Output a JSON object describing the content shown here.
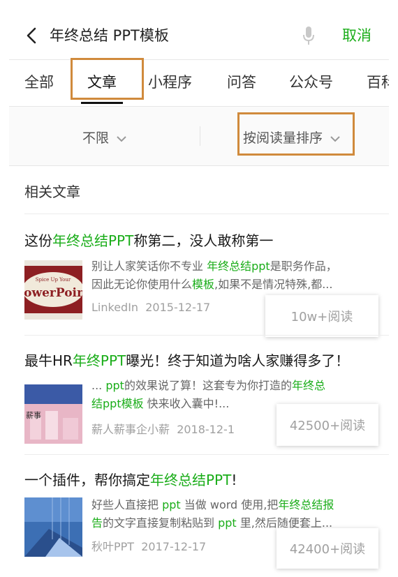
{
  "search": {
    "query": "年终总结 PPT模板",
    "cancel_label": "取消"
  },
  "tabs": [
    {
      "label": "全部"
    },
    {
      "label": "文章"
    },
    {
      "label": "小程序"
    },
    {
      "label": "问答"
    },
    {
      "label": "公众号"
    },
    {
      "label": "百科"
    }
  ],
  "active_tab": "文章",
  "filters": {
    "time_label": "不限",
    "sort_label": "按阅读量排序"
  },
  "section_title": "相关文章",
  "articles": [
    {
      "title_parts": [
        "这份",
        "年终总结PPT",
        "称第二，没人敢称第一"
      ],
      "snippet_line1": [
        "别让人家笑话你不专业 ",
        "年终总结ppt",
        "是职务作品，"
      ],
      "snippet_line2": [
        "因此无论你使用什么",
        "模板",
        ",如果不是情况特殊,都..."
      ],
      "source": "LinkedIn",
      "date": "2015-12-17",
      "reads": "10w+阅读",
      "thumb_text_top": "Spice Up Your",
      "thumb_text_main": "PowerPoint"
    },
    {
      "title_parts": [
        "最牛HR",
        "年终PPT",
        "曝光！终于知道为啥人家赚得多了！"
      ],
      "snippet_line1": [
        "... ",
        "ppt",
        "的效果说了算！这套专为你打造的",
        "年终总"
      ],
      "snippet_line2": [
        "结ppt模板",
        " 快来收入囊中!..."
      ],
      "source": "薪人薪事企小薪",
      "date": "2018-12-1",
      "reads": "42500+阅读",
      "thumb_text_main": "薪事"
    },
    {
      "title_parts": [
        "一个插件，帮你搞定",
        "年终总结PPT",
        "!"
      ],
      "snippet_line1": [
        "好些人直接把 ",
        "ppt",
        " 当做 word 使用,把",
        "年终总结报"
      ],
      "snippet_line2": [
        "告",
        "的文字直接复制粘贴到 ",
        "ppt",
        " 里,然后随便套上..."
      ],
      "source": "秋叶PPT",
      "date": "2017-12-17",
      "reads": "42400+阅读"
    }
  ],
  "colors": {
    "highlight": "#1aad19",
    "annotation_box": "#d08a3c"
  }
}
